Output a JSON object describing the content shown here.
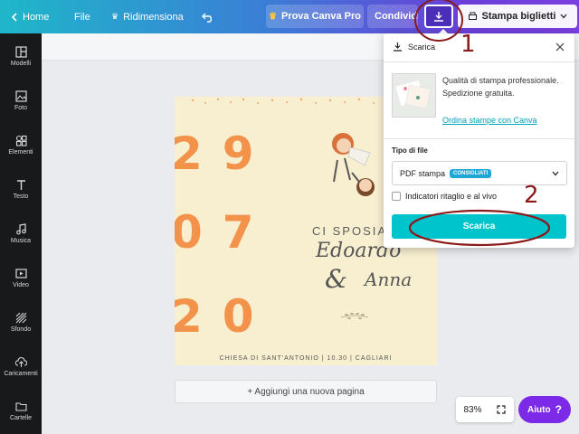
{
  "topbar": {
    "home_label": "Home",
    "file_label": "File",
    "resize_label": "Ridimensiona",
    "pro_label": "Prova Canva Pro",
    "share_label": "Condividi",
    "print_label": "Stampa biglietti"
  },
  "sidebar": {
    "items": [
      {
        "label": "Modelli",
        "icon": "layout-icon"
      },
      {
        "label": "Foto",
        "icon": "photo-icon"
      },
      {
        "label": "Elementi",
        "icon": "shapes-icon"
      },
      {
        "label": "Testo",
        "icon": "text-icon"
      },
      {
        "label": "Musica",
        "icon": "music-icon"
      },
      {
        "label": "Video",
        "icon": "video-icon"
      },
      {
        "label": "Sfondo",
        "icon": "background-icon"
      },
      {
        "label": "Caricamenti",
        "icon": "upload-icon"
      },
      {
        "label": "Cartelle",
        "icon": "folder-icon"
      }
    ]
  },
  "design": {
    "numbers": [
      "29",
      "07",
      "20"
    ],
    "headline": "CI SPOSIAMO",
    "name1": "Edoardo",
    "amp": "&",
    "name2": "Anna",
    "footer": "CHIESA DI SANT'ANTONIO | 10.30 | CAGLIARI",
    "colors": {
      "background": "#f8efd0",
      "accent": "#f2924b"
    }
  },
  "canvas": {
    "add_page_label": "+ Aggiungi una nuova pagina",
    "zoom": "83%",
    "help_label": "Aiuto",
    "help_glyph": "?"
  },
  "download_panel": {
    "title": "Scarica",
    "promo_text": "Qualità di stampa professionale. Spedizione gratuita.",
    "promo_link": "Ordina stampe con Canva",
    "filetype_label": "Tipo di file",
    "filetype_value": "PDF stampa",
    "filetype_badge": "CONSIGLIATI",
    "crop_marks_label": "Indicatori ritaglio e al vivo",
    "download_button": "Scarica"
  },
  "annotations": {
    "step1": "1",
    "step2": "2",
    "color": "#8b1a1a"
  }
}
